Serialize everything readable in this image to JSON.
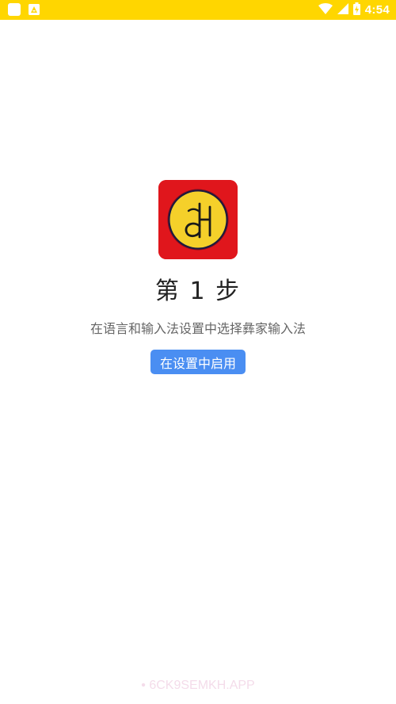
{
  "status_bar": {
    "time": "4:54",
    "background": "#FFD600",
    "left_icons": [
      "app-notification-icon",
      "image-notification-icon"
    ],
    "right_icons": [
      "wifi-icon",
      "cellular-signal-icon",
      "battery-charging-icon"
    ]
  },
  "logo": {
    "icon": "yi-keyboard-logo-icon",
    "background": "#E0161C",
    "circle_color": "#F5D02A"
  },
  "main": {
    "step_title": "第 1 步",
    "instruction": "在语言和输入法设置中选择彝家输入法",
    "enable_button_label": "在设置中启用",
    "button_color": "#4A8EF2"
  },
  "watermark": {
    "text": "• 6CK9SEMKH.APP"
  }
}
